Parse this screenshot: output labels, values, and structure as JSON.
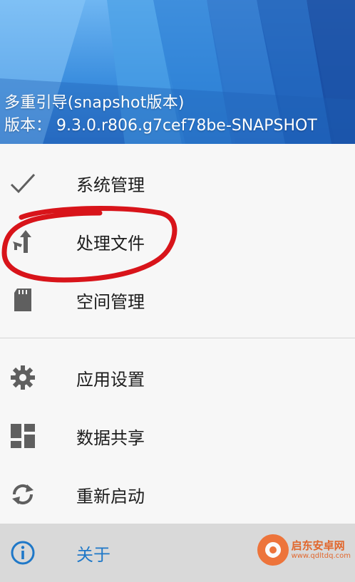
{
  "header": {
    "title": "多重引导(snapshot版本)",
    "version": "版本： 9.3.0.r806.g7cef78be-SNAPSHOT"
  },
  "menu": {
    "group1": [
      {
        "label": "系统管理",
        "icon": "check-icon"
      },
      {
        "label": "处理文件",
        "icon": "merge-arrow-icon"
      },
      {
        "label": "空间管理",
        "icon": "sd-card-icon"
      }
    ],
    "group2": [
      {
        "label": "应用设置",
        "icon": "gear-icon"
      },
      {
        "label": "数据共享",
        "icon": "dashboard-icon"
      },
      {
        "label": "重新启动",
        "icon": "refresh-icon"
      },
      {
        "label": "关于",
        "icon": "info-icon"
      }
    ]
  },
  "colors": {
    "accent": "#1f78c8",
    "icon_gray": "#5f5f5f",
    "annotation_red": "#d8141a"
  },
  "watermark": {
    "name": "启东安卓网",
    "url": "www.qdltdq.com"
  }
}
